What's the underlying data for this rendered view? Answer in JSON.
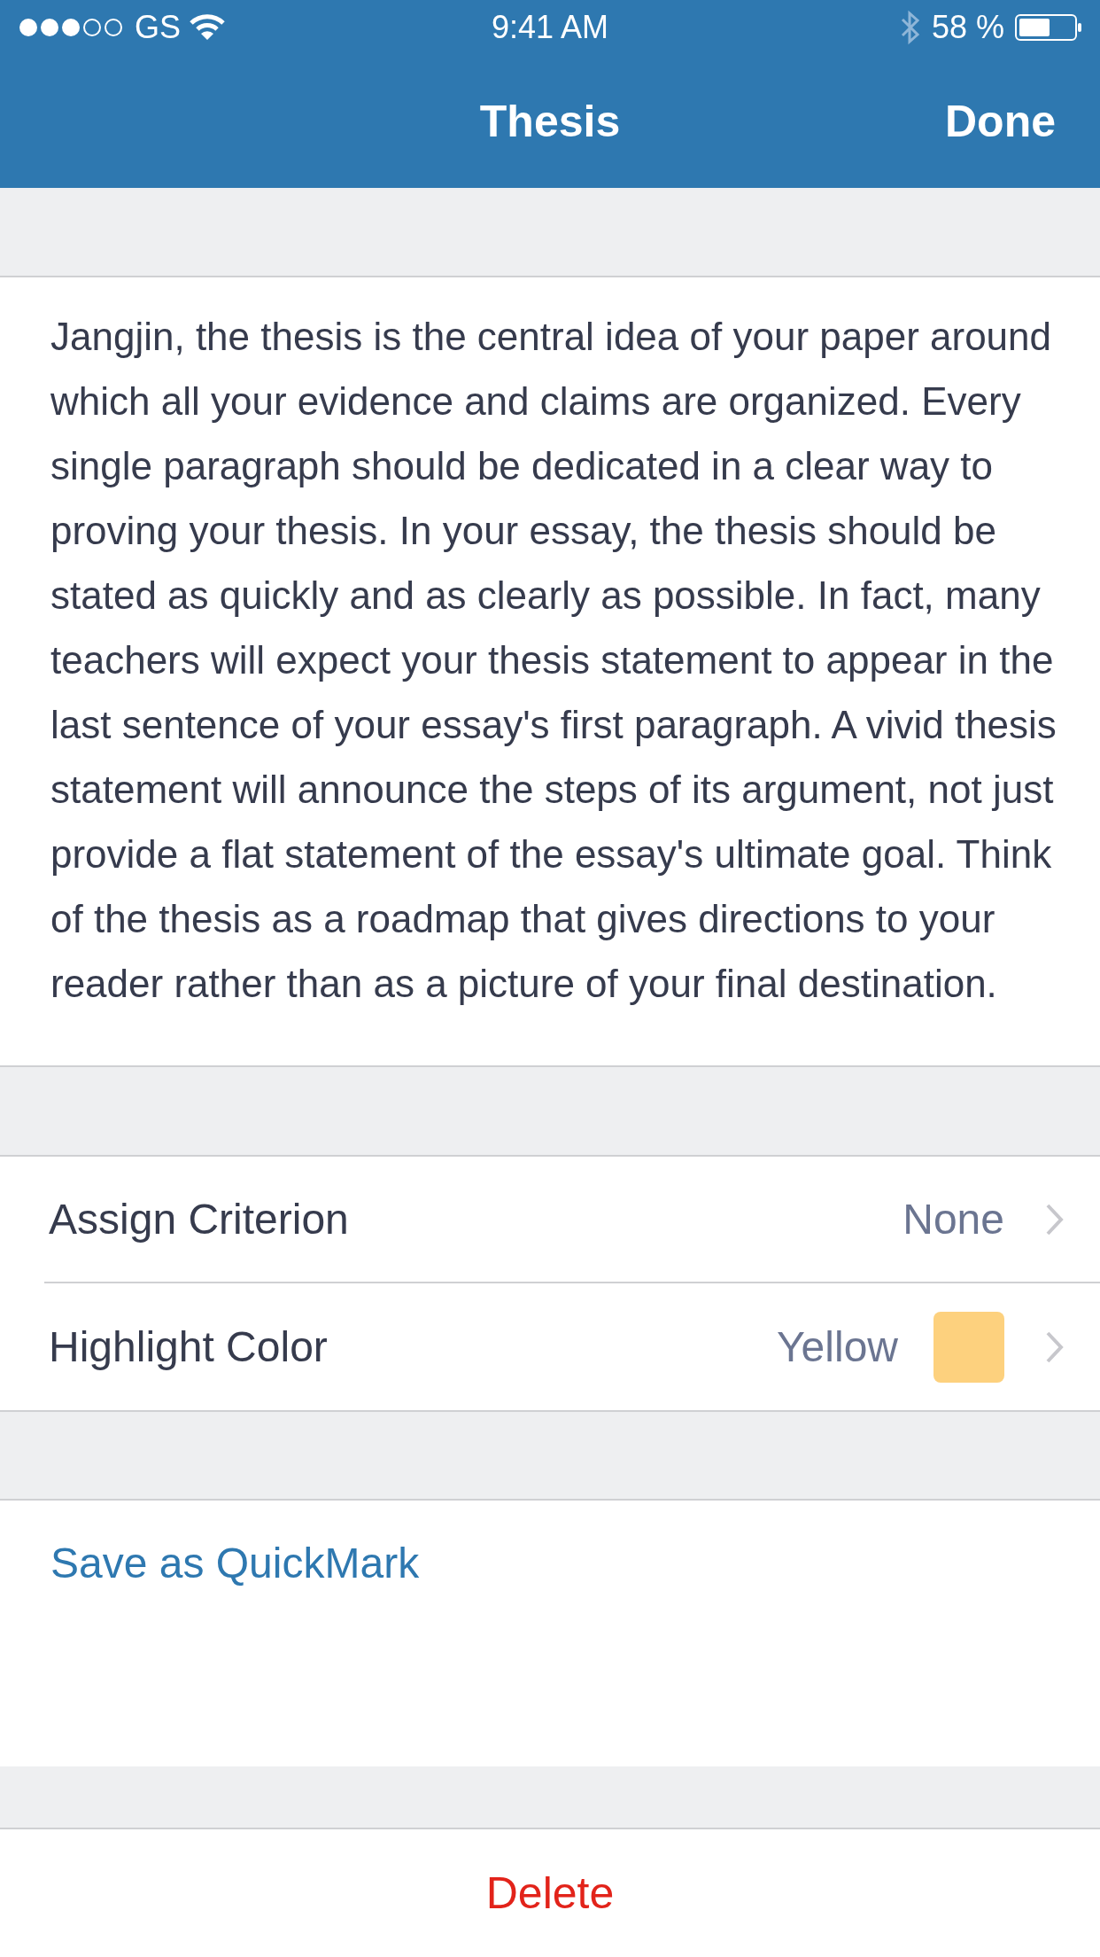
{
  "status_bar": {
    "carrier": "GS",
    "time": "9:41 AM",
    "battery": "58 %"
  },
  "nav_bar": {
    "title": "Thesis",
    "done": "Done"
  },
  "body_text": "Jangjin, the thesis is the central idea of your paper around which all your evidence and claims are organized. Every single paragraph should be dedicated in a clear way to proving your thesis. In your essay, the thesis should be stated as quickly and as clearly as possible. In fact, many teachers will expect your thesis statement to appear in the last sentence of your essay's first paragraph. A vivid thesis statement will announce the steps of its argument, not just provide a flat statement of the essay's ultimate goal. Think of the thesis as a roadmap that gives directions to your reader rather than as a picture of your final destination.",
  "settings": [
    {
      "kind": "value",
      "label": "Assign Criterion",
      "value": "None"
    },
    {
      "kind": "color",
      "label": "Highlight Color",
      "value": "Yellow",
      "color": "#fdd17e"
    }
  ],
  "save_link": "Save as QuickMark",
  "delete_button": "Delete"
}
